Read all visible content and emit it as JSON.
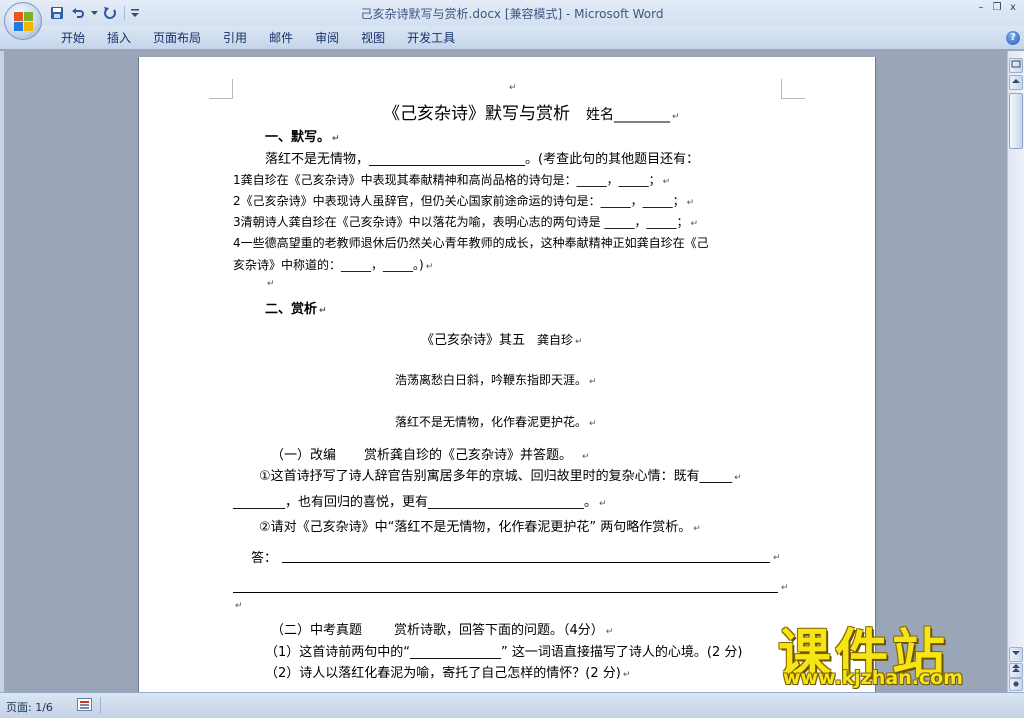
{
  "window": {
    "filename": "己亥杂诗默写与赏析.docx [兼容模式]",
    "separator": " - ",
    "app": "Microsoft Word",
    "minimize": "–",
    "restore": "❐",
    "close": "x"
  },
  "ribbon": {
    "tabs": [
      "开始",
      "插入",
      "页面布局",
      "引用",
      "邮件",
      "审阅",
      "视图",
      "开发工具"
    ],
    "help": "?"
  },
  "document": {
    "title": "《己亥杂诗》默写与赏析",
    "name_label": "姓名________",
    "section1": "一、默写。",
    "line1": "落红不是无情物，________________________。(考查此句的其他题目还有：",
    "q1": "1龚自珍在《己亥杂诗》中表现其奉献精神和高尚品格的诗句是：_____，_____；",
    "q2": "2《己亥杂诗》中表现诗人虽辞官，但仍关心国家前途命运的诗句是：_____，_____；",
    "q3": "3清朝诗人龚自珍在《己亥杂诗》中以落花为喻，表明心志的两句诗是 _____，_____；",
    "q4a": "4一些德高望重的老教师退休后仍然关心青年教师的成长，这种奉献精神正如龚自珍在《己",
    "q4b": "亥杂诗》中称道的：_____，_____。)",
    "section2": "二、赏析",
    "poem_title": "《己亥杂诗》其五",
    "poem_author": "龚自珍",
    "poem_line1": "浩荡离愁白日斜，吟鞭东指即天涯。",
    "poem_line2": "落红不是无情物，化作春泥更护花。",
    "part1_head": "（一）改编",
    "part1_task": "赏析龚自珍的《己亥杂诗》并答题。",
    "part1_q1a": "①这首诗抒写了诗人辞官告别寓居多年的京城、回归故里时的复杂心情：既有_____",
    "part1_q1b": "________，也有回归的喜悦，更有________________________。",
    "part1_q2": "②请对《己亥杂诗》中“落红不是无情物，化作春泥更护花” 两句略作赏析。",
    "answer_label": "答：",
    "part2_head": "（二）中考真题",
    "part2_task": "赏析诗歌，回答下面的问题。（4分）",
    "part2_q1": "（1）这首诗前两句中的“______________” 这一词语直接描写了诗人的心境。(2 分)",
    "part2_q2": "（2）诗人以落红化春泥为喻，寄托了自己怎样的情怀？(2 分)",
    "para_mark": "↵"
  },
  "statusbar": {
    "page": "页面: 1/6"
  },
  "watermark": {
    "brand": "课件站",
    "url": "www.kjzhan.com"
  },
  "colors": {
    "word_blue": "#3e5680",
    "watermark_yellow": "#f6e516"
  }
}
